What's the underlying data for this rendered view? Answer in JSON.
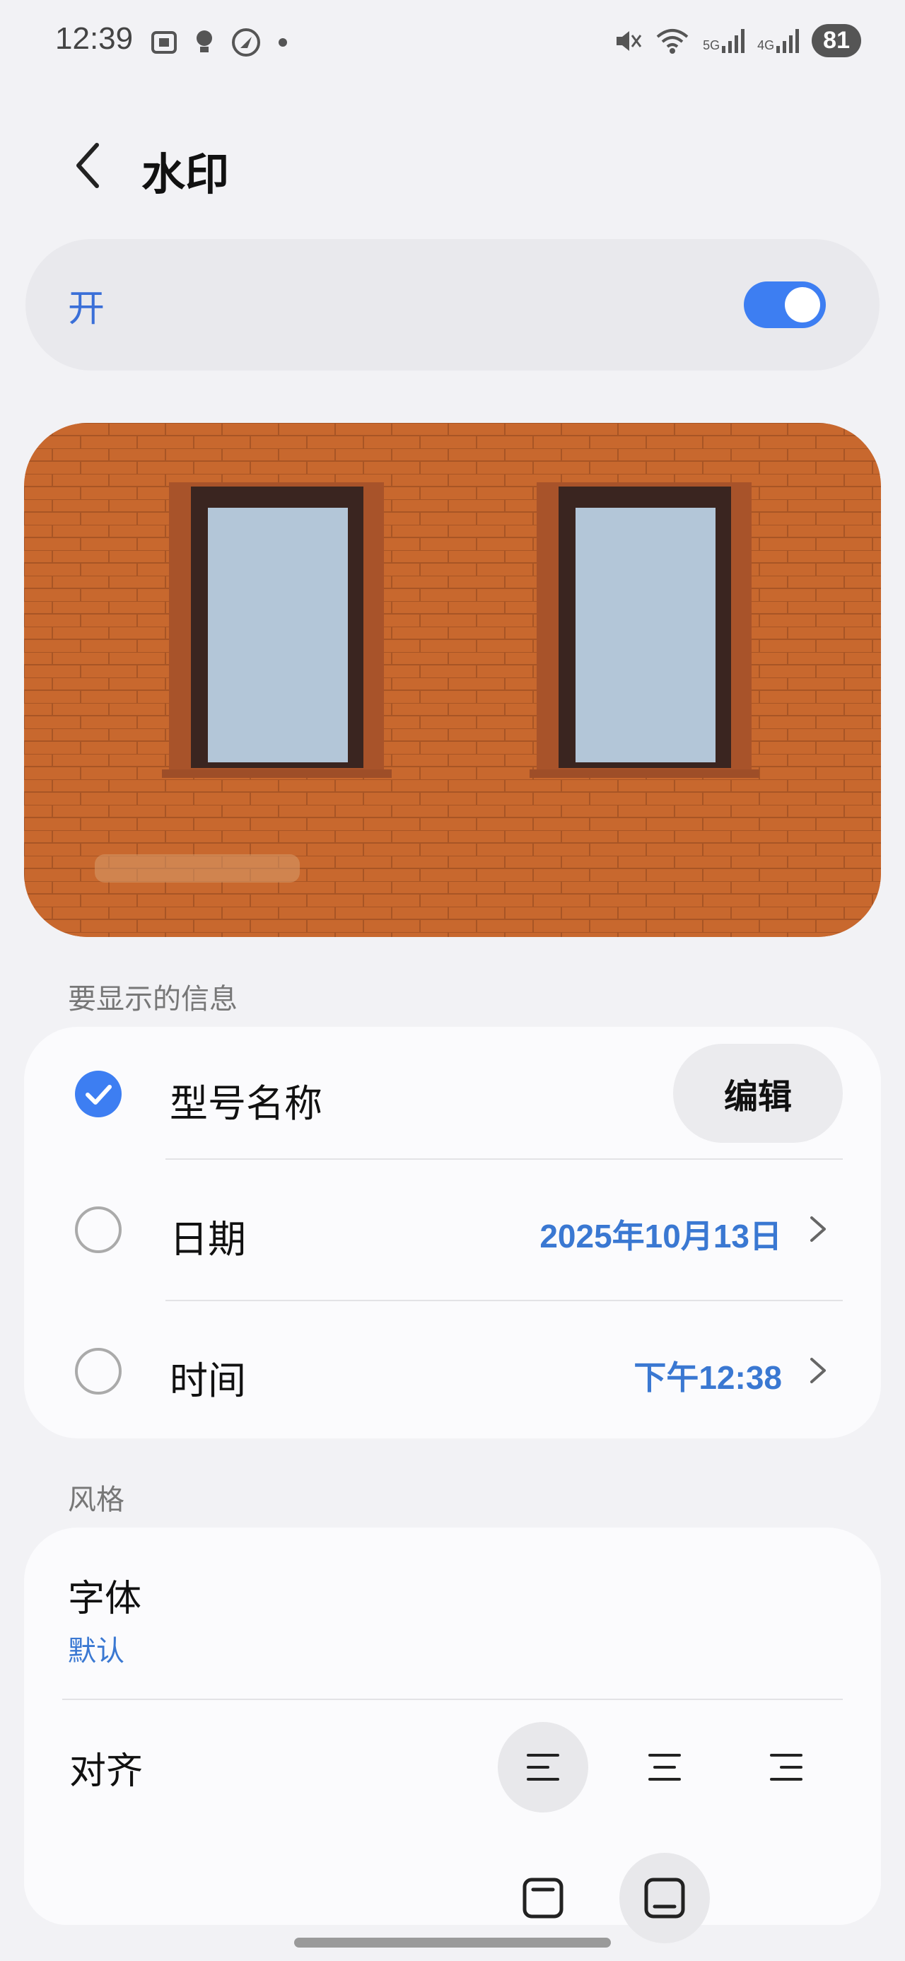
{
  "status_bar": {
    "time": "12:39",
    "network_5g": "5G",
    "network_4g": "4G",
    "battery": "81"
  },
  "header": {
    "title": "水印"
  },
  "master_toggle": {
    "label": "开",
    "on": true
  },
  "info_section": {
    "heading": "要显示的信息",
    "rows": [
      {
        "label": "型号名称",
        "checked": true,
        "action": "编辑"
      },
      {
        "label": "日期",
        "checked": false,
        "value": "2025年10月13日"
      },
      {
        "label": "时间",
        "checked": false,
        "value": "下午12:38"
      }
    ]
  },
  "style_section": {
    "heading": "风格",
    "font": {
      "label": "字体",
      "value": "默认"
    },
    "alignment": {
      "label": "对齐",
      "options": [
        "left",
        "center",
        "right"
      ],
      "selected": "left"
    },
    "position": {
      "options": [
        "top",
        "bottom"
      ],
      "selected": "bottom"
    }
  },
  "colors": {
    "accent": "#3d7ef2",
    "link": "#3a78d2",
    "background": "#f2f2f5",
    "card": "#fbfbfd",
    "brick": "#c8682e"
  }
}
